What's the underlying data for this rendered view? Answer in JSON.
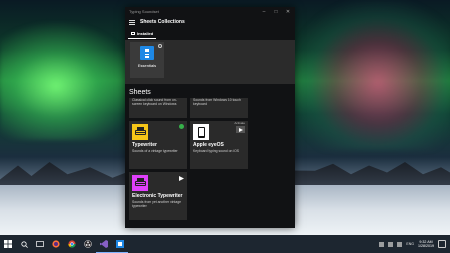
{
  "window": {
    "title": "Typing Soundset",
    "header_title": "Sheets Collections",
    "tab_installed": "Installed"
  },
  "collections": [
    {
      "label": "Essentials",
      "color": "#1e88e5"
    }
  ],
  "sheets": {
    "title": "Sheets",
    "items": [
      {
        "name": "",
        "desc": "Classical click sound from on-screen keyboard on Windows"
      },
      {
        "name": "",
        "desc": "Sounds from Windows 10 touch keyboard"
      },
      {
        "name": "Typewriter",
        "desc": "Sounds of a vintage typewriter",
        "thumb_color": "#f5c518",
        "status": "active"
      },
      {
        "name": "Apple eyeOS",
        "desc": "Keyboard typing sound on iOS",
        "thumb_color": "#ffffff",
        "action": "Activate"
      },
      {
        "name": "Electronic Typewriter",
        "desc": "Sounds from yet another vintage typewriter",
        "thumb_color": "#e040fb"
      }
    ]
  },
  "taskbar": {
    "items": [
      "windows-start-icon",
      "search-icon",
      "task-view-icon",
      "firefox-icon",
      "chrome-icon",
      "obs-icon",
      "visual-studio-icon",
      "app-icon"
    ],
    "lang": "ENG",
    "time": "9:32 AM",
    "date": "1/28/2019"
  }
}
